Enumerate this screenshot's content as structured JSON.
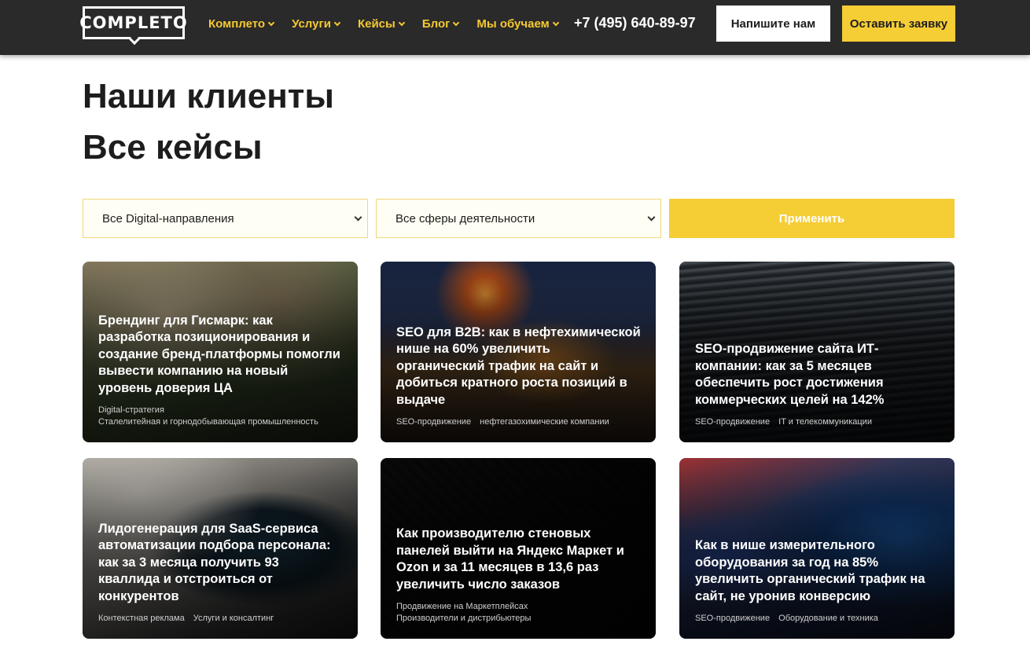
{
  "header": {
    "logo_text": "COMPLETO",
    "nav": [
      "Комплето",
      "Услуги",
      "Кейсы",
      "Блог",
      "Мы обучаем"
    ],
    "phone": "+7 (495) 640-89-97",
    "write_button": "Напишите нам",
    "request_button": "Оставить заявку"
  },
  "titles": {
    "title1": "Наши клиенты",
    "title2": "Все кейсы"
  },
  "filters": {
    "direction_value": "Все Digital-направления",
    "sphere_value": "Все сферы деятельности",
    "apply_label": "Применить"
  },
  "cards": [
    {
      "title": "Брендинг для Гисмарк: как разработка позиционирования и создание бренд-платформы помогли вывести компанию на новый уровень доверия ЦА",
      "tags": [
        "Digital-стратегия",
        "Сталелитейная и горнодобывающая промышленность"
      ]
    },
    {
      "title": "SEO для B2B: как в нефтехимической нише на 60% увеличить органический трафик на сайт и добиться кратного роста позиций в выдаче",
      "tags": [
        "SEO-продвижение",
        "нефтегазохимические компании"
      ]
    },
    {
      "title": "SEO-продвижение сайта ИТ-компании: как за 5 месяцев обеспечить рост достижения коммерческих целей на 142%",
      "tags": [
        "SEO-продвижение",
        "IT и телекоммуникации"
      ]
    },
    {
      "title": "Лидогенерация для SaaS-сервиса автоматизации подбора персонала: как за 3 месяца получить 93 кваллида и отстроиться от конкурентов",
      "tags": [
        "Контекстная реклама",
        "Услуги и консалтинг"
      ]
    },
    {
      "title": "Как производителю стеновых панелей выйти на Яндекс Маркет и Ozon и за 11 месяцев в 13,6 раз увеличить число заказов",
      "tags": [
        "Продвижение на Маркетплейсах",
        "Производители и дистрибьютеры"
      ]
    },
    {
      "title": "Как в нише измерительного оборудования за год на 85% увеличить органический трафик на сайт, не уронив конверсию",
      "tags": [
        "SEO-продвижение",
        "Оборудование и техника"
      ]
    }
  ],
  "colors": {
    "header_bg": "#2a2a2a",
    "accent": "#f5cd35",
    "nav_text": "#f5c932"
  }
}
